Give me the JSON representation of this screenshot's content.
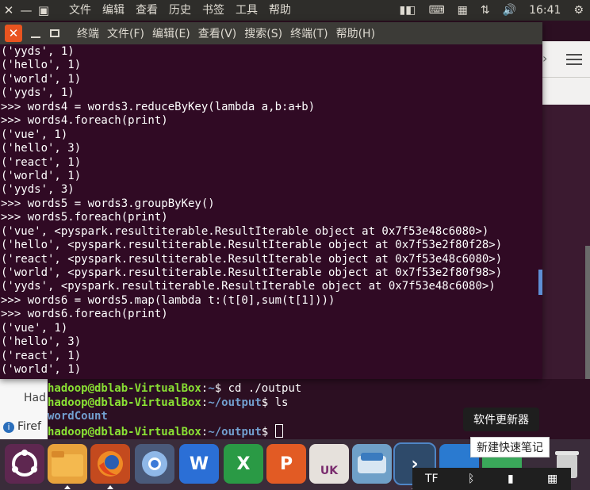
{
  "topbar": {
    "menu": [
      "文件",
      "编辑",
      "查看",
      "历史",
      "书签",
      "工具",
      "帮助"
    ],
    "time": "16:41"
  },
  "background_window": {
    "browser_label": "Had",
    "firefox_label": "Firef"
  },
  "terminal": {
    "menu": [
      "终端",
      "文件(F)",
      "编辑(E)",
      "查看(V)",
      "搜索(S)",
      "终端(T)",
      "帮助(H)"
    ],
    "lines": [
      "('yyds', 1)",
      "('hello', 1)",
      "('world', 1)",
      "('yyds', 1)",
      ">>> words4 = words3.reduceByKey(lambda a,b:a+b)",
      ">>> words4.foreach(print)",
      "('vue', 1)",
      "('hello', 3)",
      "('react', 1)",
      "('world', 1)",
      "('yyds', 3)",
      ">>> words5 = words3.groupByKey()",
      ">>> words5.foreach(print)",
      "('vue', <pyspark.resultiterable.ResultIterable object at 0x7f53e48c6080>)",
      "('hello', <pyspark.resultiterable.ResultIterable object at 0x7f53e2f80f28>)",
      "('react', <pyspark.resultiterable.ResultIterable object at 0x7f53e48c6080>)",
      "('world', <pyspark.resultiterable.ResultIterable object at 0x7f53e2f80f98>)",
      "('yyds', <pyspark.resultiterable.ResultIterable object at 0x7f53e48c6080>)",
      ">>> words6 = words5.map(lambda t:(t[0],sum(t[1])))",
      ">>> words6.foreach(print)",
      "('vue', 1)",
      "('hello', 3)",
      "('react', 1)",
      "('world', 1)"
    ]
  },
  "terminal2": {
    "prompt_user": "hadoop@dblab-VirtualBox",
    "prompt1_path": "~",
    "cmd1": " cd ./output",
    "prompt2_path": "~/output",
    "cmd2": " ls",
    "ls_output": "wordCount",
    "prompt3_path": "~/output"
  },
  "tooltips": {
    "updater": "软件更新器",
    "new_note": "新建快速笔记"
  },
  "dock": {
    "word_label": "W",
    "excel_label": "X",
    "ppt_label": "P",
    "uk_label": "UK"
  }
}
